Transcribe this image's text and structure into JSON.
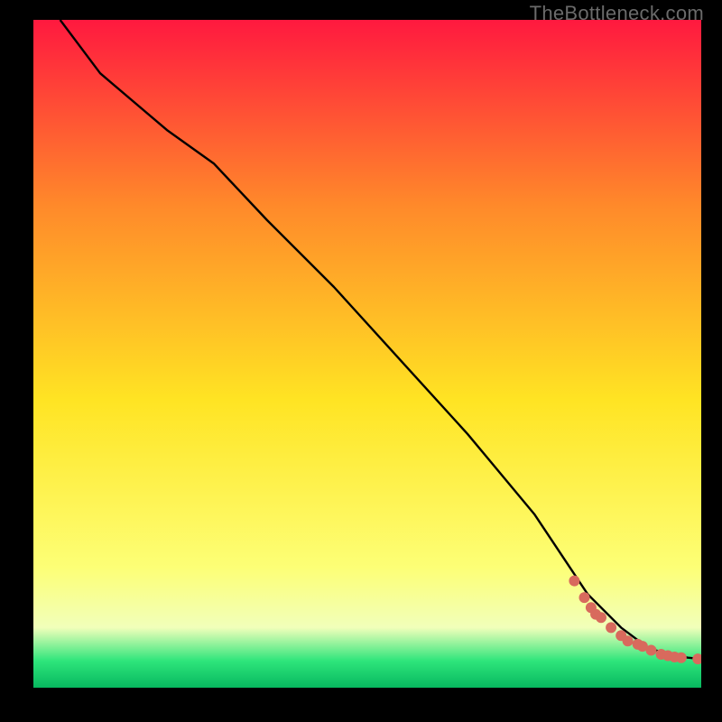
{
  "watermark": "TheBottleneck.com",
  "chart_data": {
    "type": "line",
    "title": "",
    "xlabel": "",
    "ylabel": "",
    "xlim": [
      0,
      100
    ],
    "ylim": [
      0,
      100
    ],
    "gradient_background": {
      "top_color": "#ff193f",
      "upper_mid_color": "#ff8a2a",
      "mid_color": "#ffe423",
      "lower_mid_color": "#fdff76",
      "pale_color": "#f1ffba",
      "green_color": "#2ee57b",
      "bottom_color": "#07b85f"
    },
    "curve": {
      "description": "Decreasing curve with a kink at roughly x=27, y=80; linear descent to x≈83, y≈7; then flattens.",
      "x": [
        4,
        10,
        20,
        27,
        35,
        45,
        55,
        65,
        75,
        83,
        88,
        92,
        95,
        98,
        100
      ],
      "y": [
        100,
        92,
        83.5,
        78.5,
        70,
        60,
        49,
        38,
        26,
        14,
        9,
        6,
        5,
        4.5,
        4.3
      ]
    },
    "scatter": {
      "description": "Coral dots clustered along the flat tail region of the curve.",
      "color": "#d86a5d",
      "x": [
        81,
        82.5,
        83.5,
        84.2,
        85,
        86.5,
        88,
        89,
        90.5,
        91.2,
        92.5,
        94,
        95,
        96,
        97,
        99.5
      ],
      "y": [
        16,
        13.5,
        12,
        11,
        10.5,
        9,
        7.8,
        7,
        6.5,
        6.2,
        5.6,
        5.0,
        4.8,
        4.6,
        4.5,
        4.3
      ]
    }
  }
}
